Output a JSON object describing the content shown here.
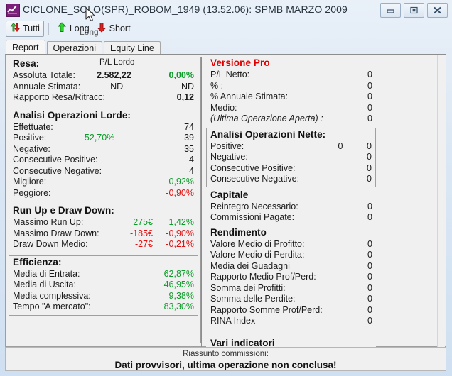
{
  "window": {
    "title": "CICLONE_SOLO(SPR)_ROBOM_1949 (13.52.06): SPMB MARZO 2009",
    "icon": "chart-icon",
    "minimize_label": "–",
    "restore_label": "□",
    "close_label": "✕"
  },
  "toolbar": {
    "all_label": "Tutti",
    "long_label": "Long",
    "short_label": "Short",
    "ghost_label": "Long"
  },
  "tabs": [
    {
      "label": "Report",
      "active": true
    },
    {
      "label": "Operazioni",
      "active": false
    },
    {
      "label": "Equity Line",
      "active": false
    }
  ],
  "left": {
    "resa": {
      "title": "Resa:",
      "subhead": "P/L Lordo",
      "rows": [
        {
          "label": "Assoluta Totale:",
          "value": "2.582,22",
          "pct": "0,00%",
          "value_style": "bold",
          "pct_style": "green bold"
        },
        {
          "label": "Annuale Stimata:",
          "value": "ND",
          "pct": "ND",
          "value_style": "",
          "pct_style": ""
        },
        {
          "label": "Rapporto Resa/Ritracc:",
          "value": "",
          "pct": "0,12",
          "value_style": "",
          "pct_style": "bold"
        }
      ]
    },
    "analisi_lorde": {
      "title": "Analisi Operazioni Lorde:",
      "rows": [
        {
          "label": "Effettuate:",
          "mid": "",
          "value": "74",
          "mid_style": "",
          "value_style": ""
        },
        {
          "label": "Positive:",
          "mid": "52,70%",
          "value": "39",
          "mid_style": "green",
          "value_style": ""
        },
        {
          "label": "Negative:",
          "mid": "",
          "value": "35",
          "mid_style": "",
          "value_style": ""
        },
        {
          "label": "Consecutive Positive:",
          "mid": "",
          "value": "4",
          "mid_style": "",
          "value_style": ""
        },
        {
          "label": "Consecutive Negative:",
          "mid": "",
          "value": "4",
          "mid_style": "",
          "value_style": ""
        },
        {
          "label": "Migliore:",
          "mid": "",
          "value": "0,92%",
          "mid_style": "",
          "value_style": "green"
        },
        {
          "label": "Peggiore:",
          "mid": "",
          "value": "-0,90%",
          "mid_style": "",
          "value_style": "red"
        }
      ]
    },
    "runup_drawdown": {
      "title": "Run Up e Draw Down:",
      "rows": [
        {
          "label": "Massimo Run Up:",
          "value": "275€",
          "pct": "1,42%",
          "style": "green"
        },
        {
          "label": "Massimo Draw Down:",
          "value": "-185€",
          "pct": "-0,90%",
          "style": "red"
        },
        {
          "label": "Draw Down Medio:",
          "value": "-27€",
          "pct": "-0,21%",
          "style": "red"
        }
      ]
    },
    "efficienza": {
      "title": "Efficienza:",
      "rows": [
        {
          "label": "Media di Entrata:",
          "value": "62,87%",
          "style": "green"
        },
        {
          "label": "Media di Uscita:",
          "value": "46,95%",
          "style": "green"
        },
        {
          "label": "Media complessiva:",
          "value": "9,38%",
          "style": "green"
        },
        {
          "label": "Tempo \"A mercato\":",
          "value": "83,30%",
          "style": "green"
        }
      ]
    }
  },
  "right": {
    "versione_pro": {
      "title": "Versione Pro",
      "rows": [
        {
          "label": "P/L Netto:",
          "value": "0",
          "italic": false
        },
        {
          "label": "% :",
          "value": "0",
          "italic": false
        },
        {
          "label": "% Annuale Stimata:",
          "value": "0",
          "italic": false
        },
        {
          "label": "Medio:",
          "value": "0",
          "italic": false
        },
        {
          "label": "(Ultima Operazione Aperta) :",
          "value": "0",
          "italic": true
        }
      ]
    },
    "analisi_nette": {
      "title": "Analisi Operazioni Nette:",
      "rows": [
        {
          "label": "Positive:",
          "mid": "0",
          "value": "0"
        },
        {
          "label": "Negative:",
          "mid": "",
          "value": "0"
        },
        {
          "label": "Consecutive Positive:",
          "mid": "",
          "value": "0"
        },
        {
          "label": "Consecutive Negative:",
          "mid": "",
          "value": "0"
        }
      ]
    },
    "capitale": {
      "title": "Capitale",
      "rows": [
        {
          "label": "Reintegro Necessario:",
          "value": "0"
        },
        {
          "label": "Commissioni Pagate:",
          "value": "0"
        }
      ]
    },
    "rendimento": {
      "title": "Rendimento",
      "rows": [
        {
          "label": "Valore Medio di Profitto:",
          "value": "0"
        },
        {
          "label": "Valore Medio di Perdita:",
          "value": "0"
        },
        {
          "label": "Media dei Guadagni",
          "value": "0"
        },
        {
          "label": "Rapporto Medio Prof/Perd:",
          "value": "0"
        },
        {
          "label": "Somma dei Profitti:",
          "value": "0"
        },
        {
          "label": "Somma delle Perdite:",
          "value": "0"
        },
        {
          "label": "Rapporto Somme Prof/Perd:",
          "value": "0"
        },
        {
          "label": "RINA Index",
          "value": "0"
        }
      ]
    },
    "vari_indicatori": {
      "title": "Vari indicatori"
    }
  },
  "footer": {
    "line1": "Riassunto commissioni:",
    "line2": "Dati provvisori, ultima operazione non conclusa!"
  },
  "colors": {
    "positive": "#0a9c28",
    "negative": "#e21010",
    "pro_header": "#e00000",
    "title_text": "#27343f"
  }
}
